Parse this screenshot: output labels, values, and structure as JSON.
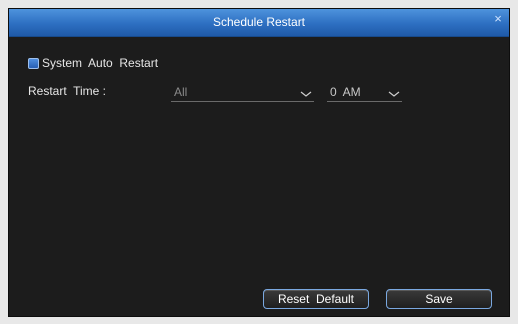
{
  "window": {
    "title": "Schedule Restart",
    "close_glyph": "×"
  },
  "auto_restart": {
    "label": "System  Auto  Restart",
    "checked": true
  },
  "restart_time": {
    "label": "Restart  Time :",
    "day": {
      "value": "All",
      "icon": "chevron-down-icon"
    },
    "hour": {
      "value": "0  AM",
      "icon": "chevron-down-icon"
    }
  },
  "buttons": {
    "reset_default": "Reset  Default",
    "save": "Save"
  },
  "colors": {
    "title_bar": "#2d6fc1",
    "background": "#1c1c1c",
    "accent": "#4f8fe0"
  }
}
